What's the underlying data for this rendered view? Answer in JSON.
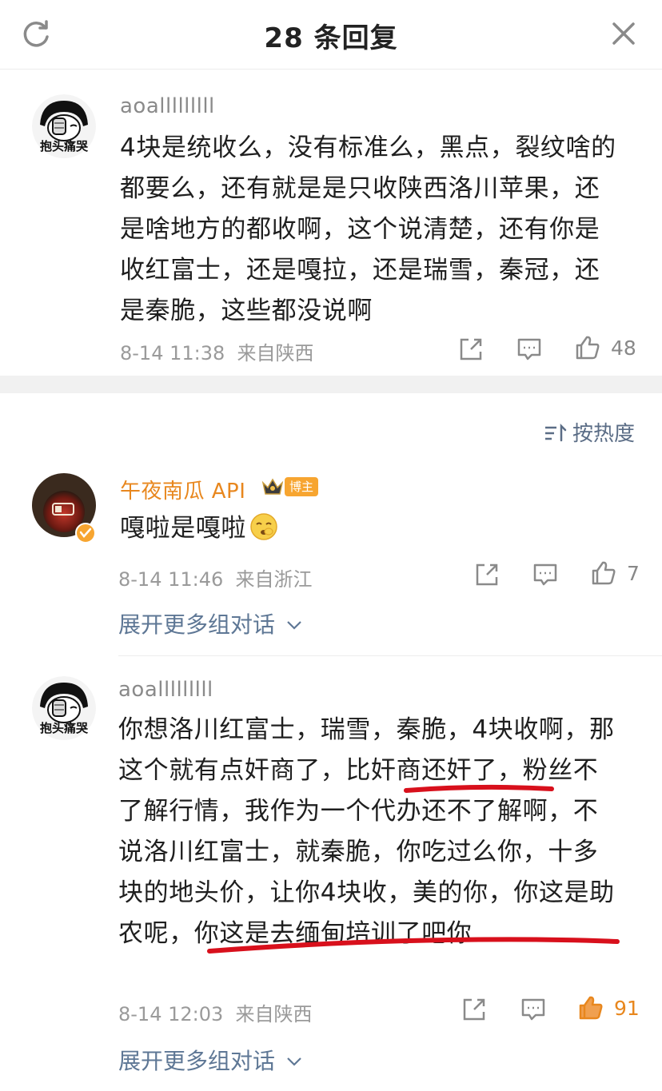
{
  "header": {
    "title": "28 条回复",
    "refresh_icon": "refresh-icon",
    "close_icon": "close-icon"
  },
  "root_comment": {
    "username": "aoalllllllll",
    "avatar_caption": "抱头痛哭",
    "content": "4块是统收么，没有标准么，黑点，裂纹啥的都要么，还有就是是只收陕西洛川苹果，还是啥地方的都收啊，这个说清楚，还有你是收红富士，还是嘎拉，还是瑞雪，秦冠，还是秦脆，这些都没说啊",
    "time": "8-14 11:38",
    "location": "来自陕西",
    "likes": "48"
  },
  "sort": {
    "label": "按热度",
    "icon": "sort-icon"
  },
  "replies": [
    {
      "username": "午夜南瓜 API",
      "badge": "博主",
      "content": "嘎啦是嘎啦",
      "time": "8-14 11:46",
      "location": "来自浙江",
      "likes": "7",
      "expand_label": "展开更多组对话"
    },
    {
      "username": "aoalllllllll",
      "avatar_caption": "抱头痛哭",
      "content": "你想洛川红富士，瑞雪，秦脆，4块收啊，那这个就有点奸商了，比奸商还奸了，粉丝不了解行情，我作为一个代办还不了解啊，不说洛川红富士，就秦脆，你吃过么你，十多块的地头价，让你4块收，美的你，你这是助农呢，你这是去缅甸培训了吧你",
      "time": "8-14 12:03",
      "location": "来自陕西",
      "likes": "91",
      "liked": true,
      "expand_label": "展开更多组对话"
    }
  ],
  "colors": {
    "accent_orange": "#e8871e",
    "link_blue": "#5e7795",
    "annotation_red": "#d8101c"
  }
}
